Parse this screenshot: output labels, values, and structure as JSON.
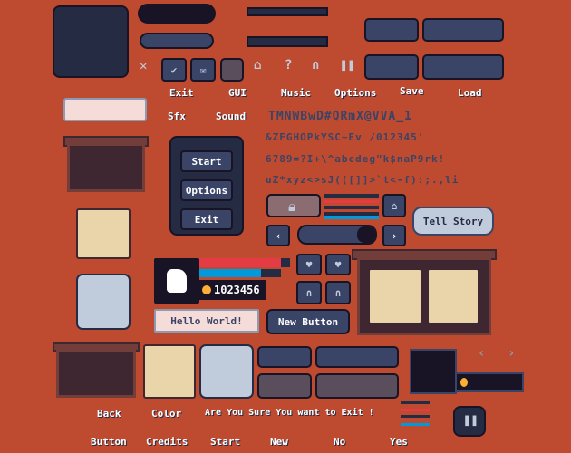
{
  "labels": {
    "exit": "Exit",
    "gui": "GUI",
    "music": "Music",
    "options": "Options",
    "save": "Save",
    "load": "Load",
    "sfx": "Sfx",
    "sound": "Sound",
    "back": "Back",
    "color": "Color",
    "confirm": "Are You Sure You want to Exit !",
    "button": "Button",
    "credits": "Credits",
    "start": "Start",
    "new": "New",
    "no": "No",
    "yes": "Yes"
  },
  "font_sample": [
    "TMNWBwD#QRmX@VVA_1",
    "&ZFGHOPkYSC~Ev /012345'",
    "6789=?I+\\^abcdeg\"k$naP9rk!",
    "uZ*xyz<>sJ(([]]>`t<-f):;.,li"
  ],
  "menu": {
    "start": "Start",
    "options": "Options",
    "exit": "Exit"
  },
  "tell_story": "Tell Story",
  "hello": "Hello World!",
  "new_button": "New Button",
  "hud": {
    "coins": "1023456",
    "health": 0.9,
    "mana": 0.75
  },
  "icons": [
    "close-icon",
    "check-icon",
    "mail-icon",
    "home-icon",
    "question-icon",
    "headphones-icon",
    "pause-icon",
    "lock-icon",
    "heart-icon",
    "chevron-left-icon",
    "chevron-right-icon"
  ],
  "colors": {
    "background": "#be4a2f",
    "navy": "#3a4466",
    "dark": "#262b44",
    "beige": "#ead4aa",
    "health": "#e43b44",
    "mana": "#0099db"
  }
}
